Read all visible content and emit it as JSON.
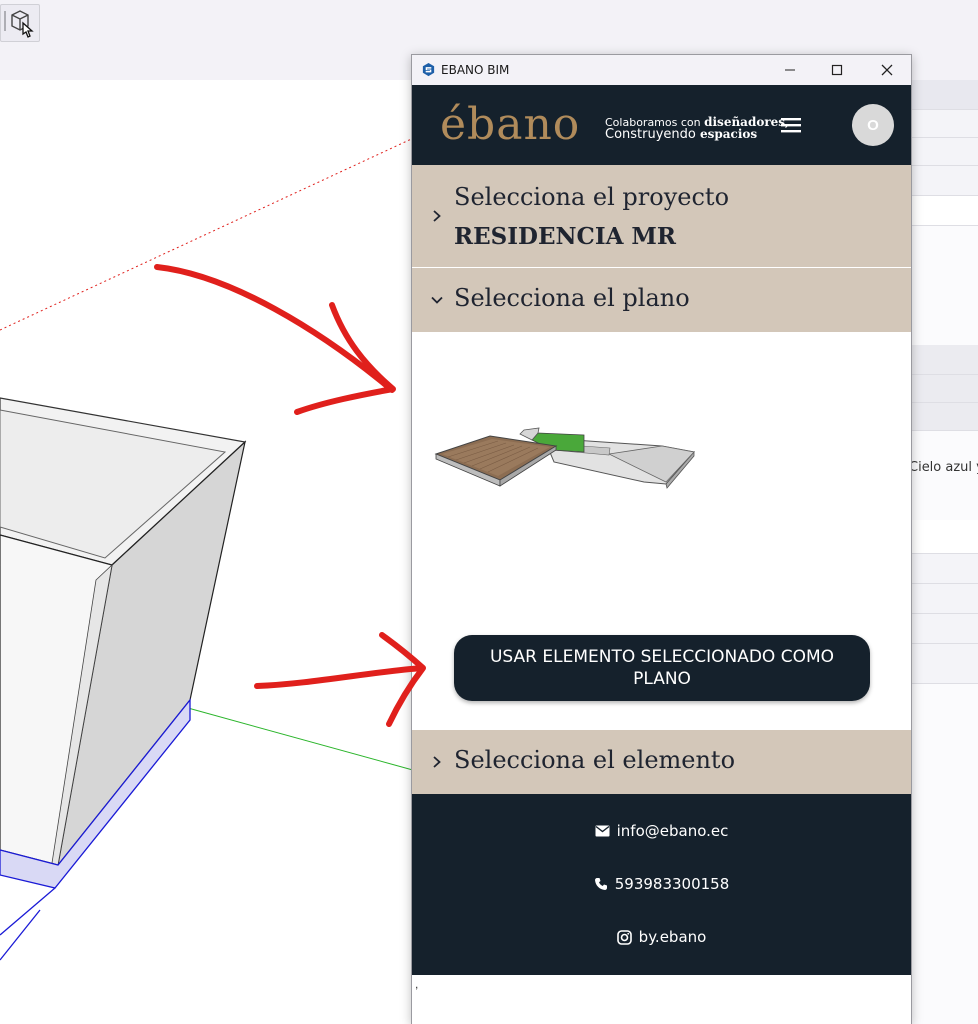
{
  "window": {
    "title": "EBANO BIM",
    "controls": [
      "minimize-icon",
      "maximize-icon",
      "close-icon"
    ]
  },
  "header": {
    "logo": "ébano",
    "tagline_line1_prefix": "Colaboramos con ",
    "tagline_line1_bold": "diseñadores,",
    "tagline_line2_prefix": "Construyendo ",
    "tagline_line2_bold": "espacios",
    "avatar_initial": "O"
  },
  "sections": {
    "project": {
      "title": "Selecciona el proyecto",
      "value": "RESIDENCIA MR",
      "expanded": false
    },
    "plan": {
      "title": "Selecciona el plano",
      "expanded": true,
      "button_label": "USAR ELEMENTO SELECCIONADO COMO PLANO"
    },
    "element": {
      "title": "Selecciona el elemento",
      "expanded": false
    }
  },
  "footer": {
    "email": "info@ebano.ec",
    "phone": "593983300158",
    "instagram": "by.ebano"
  },
  "background": {
    "side_panel_text": "Cielo azul y c",
    "trailing_text": ","
  },
  "colors": {
    "header_bg": "#15212c",
    "logo_gold": "#b08b5b",
    "section_bg": "#d3c7b9",
    "arrow_red": "#e0201c"
  }
}
